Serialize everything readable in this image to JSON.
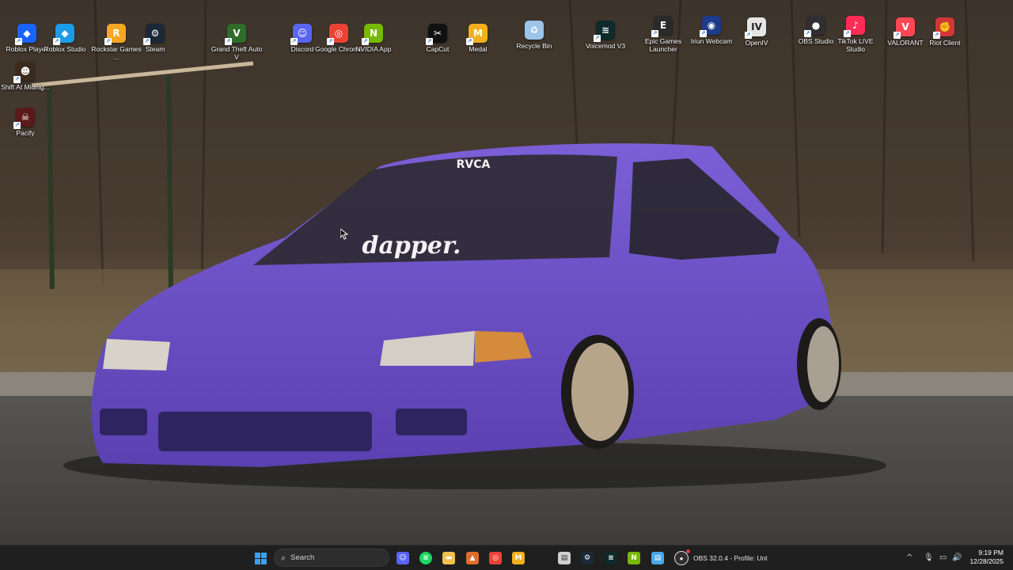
{
  "desktop": {
    "icons": [
      {
        "label": "Roblox Player",
        "icon": "roblox-player-icon",
        "color": "#1a63ff"
      },
      {
        "label": "Roblox Studio",
        "icon": "roblox-studio-icon",
        "color": "#1c9ce6"
      },
      {
        "label": "Rockstar Games ...",
        "icon": "rockstar-games-icon",
        "color": "#f5a623"
      },
      {
        "label": "Steam",
        "icon": "steam-icon",
        "color": "#1b2838"
      },
      {
        "label": "Grand Theft Auto V",
        "icon": "gta-v-icon",
        "color": "#2f6d2b"
      },
      {
        "label": "Discord",
        "icon": "discord-icon",
        "color": "#5865f2"
      },
      {
        "label": "Google Chrome",
        "icon": "chrome-icon",
        "color": "#ea4335"
      },
      {
        "label": "NVIDIA App",
        "icon": "nvidia-icon",
        "color": "#76b900"
      },
      {
        "label": "CapCut",
        "icon": "capcut-icon",
        "color": "#111111"
      },
      {
        "label": "Medal",
        "icon": "medal-icon",
        "color": "#f2b01e"
      },
      {
        "label": "Recycle Bin",
        "icon": "recycle-bin-icon",
        "color": "#9bc4e8"
      },
      {
        "label": "Voicemod V3",
        "icon": "voicemod-icon",
        "color": "#0e2a2a"
      },
      {
        "label": "Epic Games Launcher",
        "icon": "epic-games-icon",
        "color": "#2a2a2a"
      },
      {
        "label": "Iriun Webcam",
        "icon": "iriun-webcam-icon",
        "color": "#1e3a8a"
      },
      {
        "label": "OpenIV",
        "icon": "openiv-icon",
        "color": "#e5e5e5"
      },
      {
        "label": "OBS Studio",
        "icon": "obs-studio-icon",
        "color": "#302e31"
      },
      {
        "label": "TikTok LIVE Studio",
        "icon": "tiktok-live-icon",
        "color": "#ff2d55"
      },
      {
        "label": "VALORANT",
        "icon": "valorant-icon",
        "color": "#ff4655"
      },
      {
        "label": "Riot Client",
        "icon": "riot-client-icon",
        "color": "#d13639"
      },
      {
        "label": "Shift At Midnig...",
        "icon": "shift-at-midnight-icon",
        "color": "#3b2a1e"
      },
      {
        "label": "Pacify",
        "icon": "pacify-icon",
        "color": "#5a1a1a"
      }
    ]
  },
  "wallpaper": {
    "windshield_banner": "dapper.",
    "windshield_brand": "RVCA",
    "car_color": "#6a4ec2"
  },
  "taskbar": {
    "search_placeholder": "Search",
    "pinned": [
      {
        "icon": "discord-icon",
        "color": "#5865f2"
      },
      {
        "icon": "spotify-icon",
        "color": "#1ed760"
      },
      {
        "icon": "file-explorer-icon",
        "color": "#f3c14b"
      },
      {
        "icon": "artstation-icon",
        "color": "#e06c2c"
      },
      {
        "icon": "chrome-icon",
        "color": "#ea4335"
      },
      {
        "icon": "medal-icon",
        "color": "#f2b01e"
      },
      {
        "icon": "notepad-icon",
        "color": "#cfcfcf"
      },
      {
        "icon": "steam-icon",
        "color": "#1b2838"
      },
      {
        "icon": "voicemod-icon",
        "color": "#0e2a2a"
      },
      {
        "icon": "nvidia-icon",
        "color": "#76b900"
      },
      {
        "icon": "notepad-plus-icon",
        "color": "#4aa7e8"
      }
    ],
    "running_app": "OBS 32.0.4 - Profile: Unt",
    "clock": {
      "time": "9:19 PM",
      "date": "12/28/2025"
    }
  }
}
